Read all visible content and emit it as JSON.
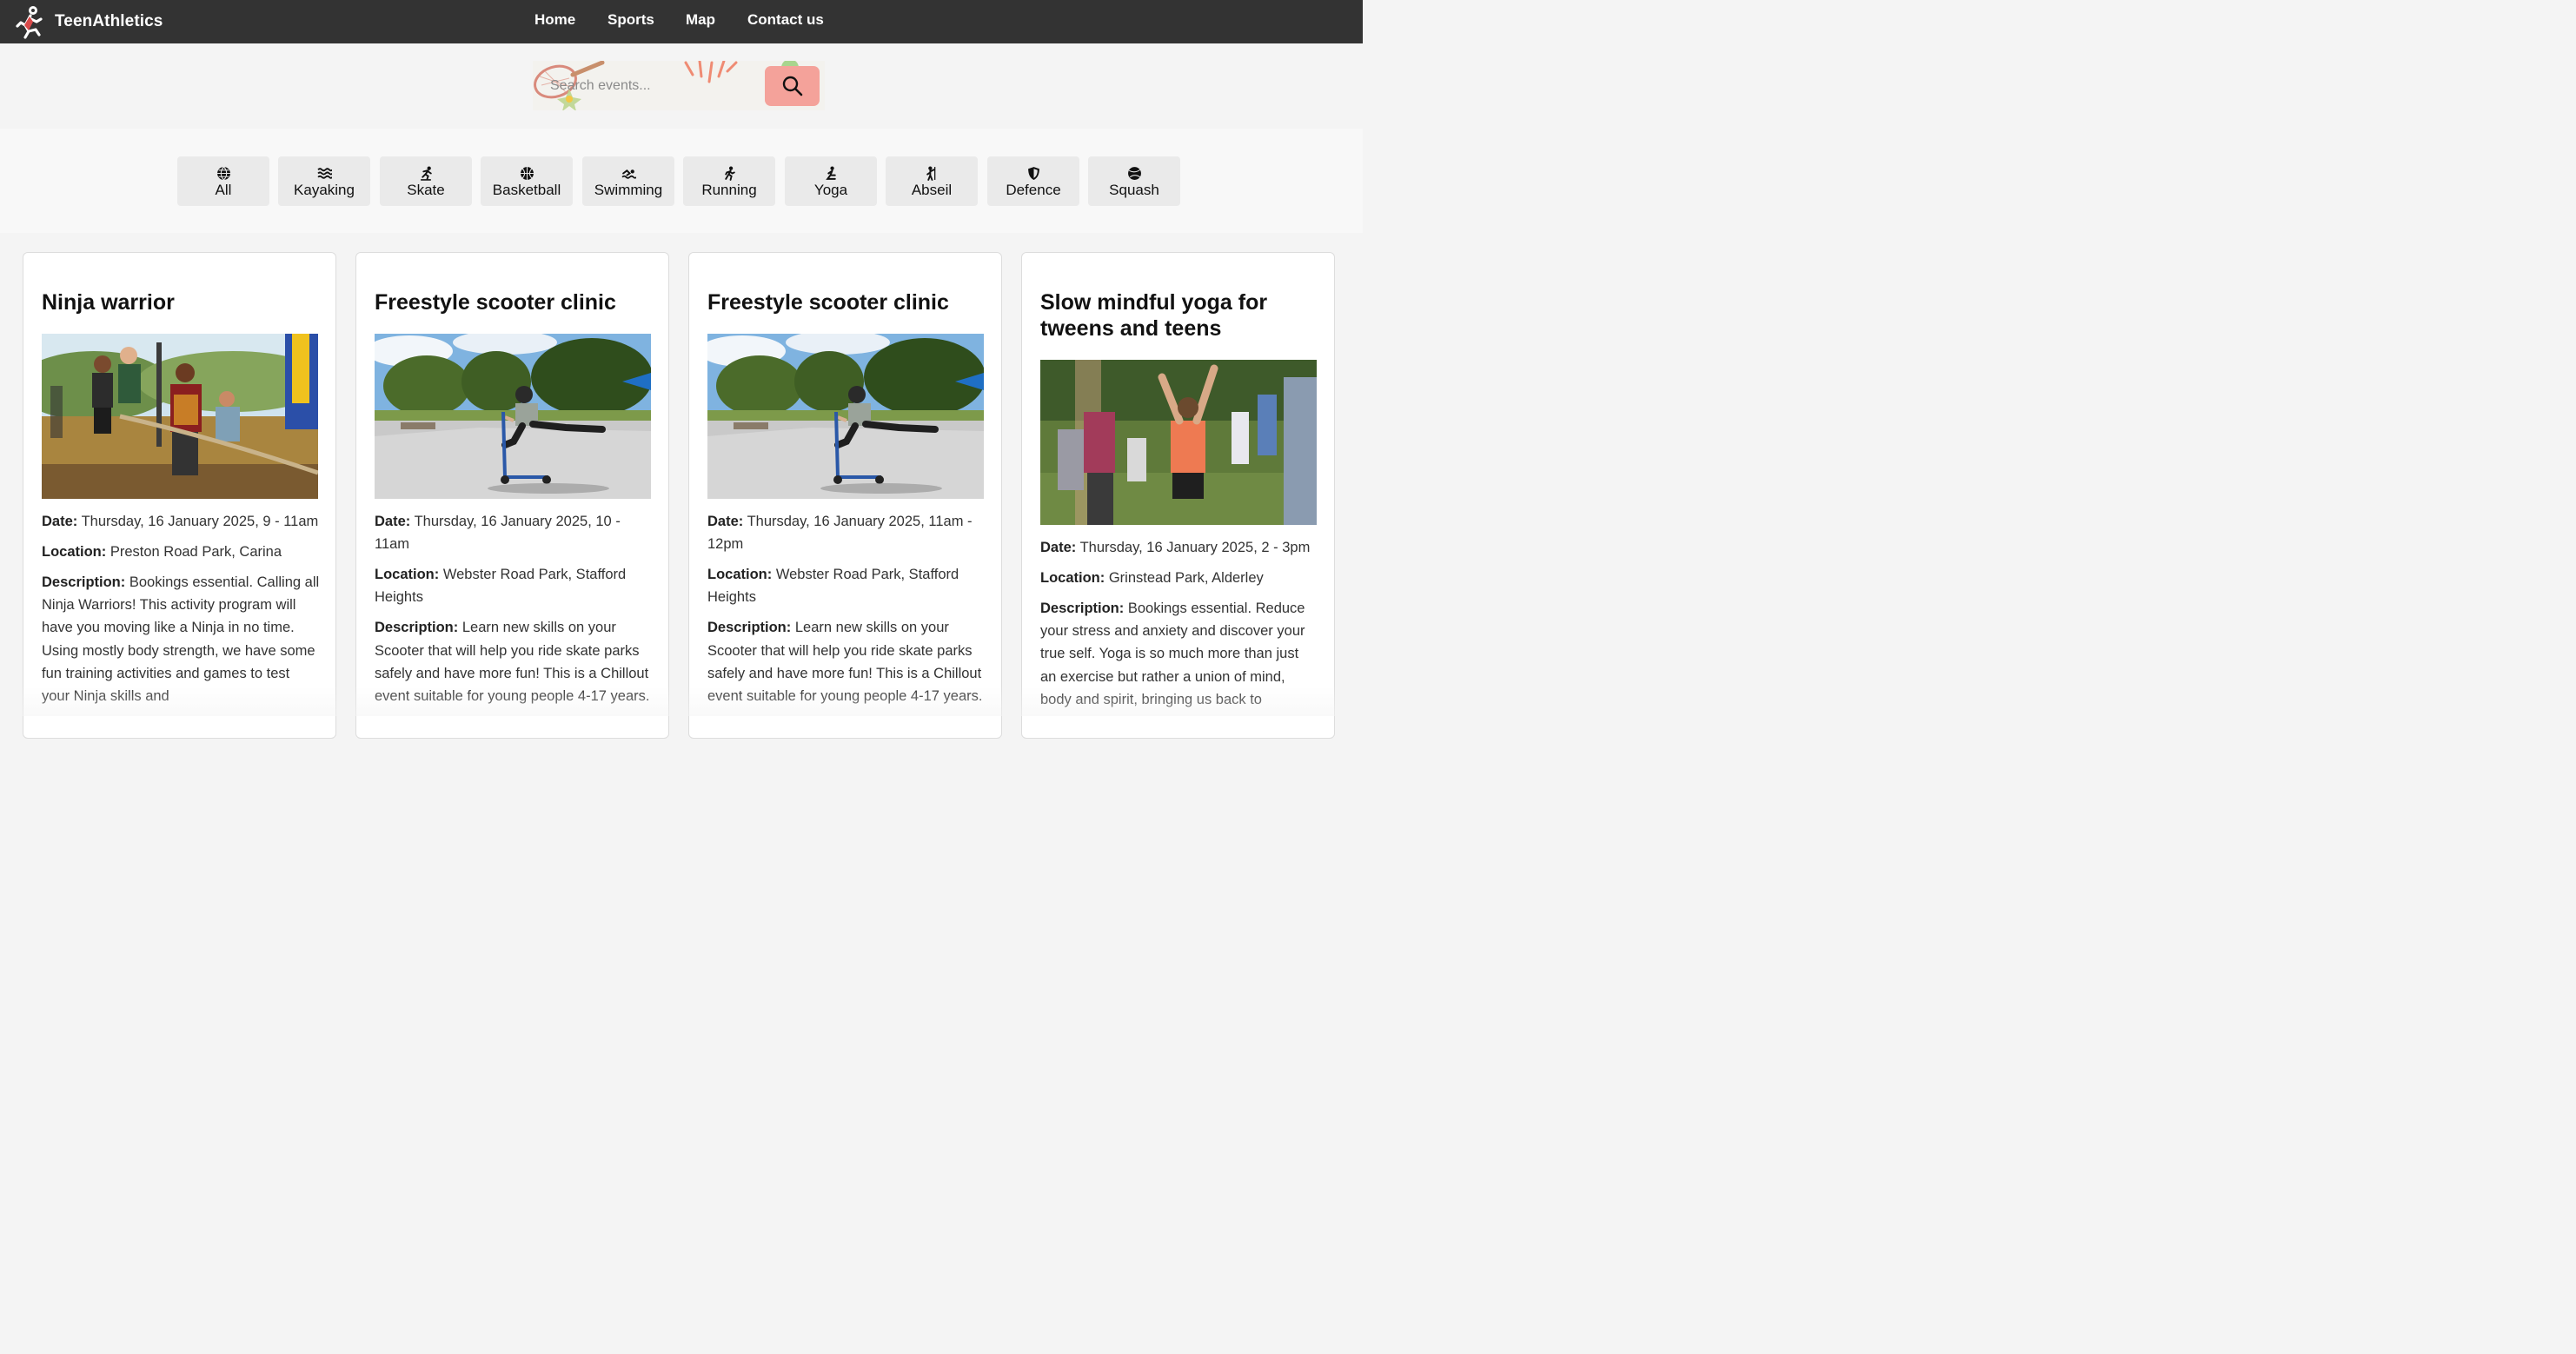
{
  "nav": {
    "brand": "TeenAthletics",
    "links": [
      "Home",
      "Sports",
      "Map",
      "Contact us"
    ]
  },
  "search": {
    "placeholder": "Search events..."
  },
  "filters": [
    {
      "label": "All",
      "icon": "globe-icon"
    },
    {
      "label": "Kayaking",
      "icon": "water-waves-icon"
    },
    {
      "label": "Skate",
      "icon": "skater-icon"
    },
    {
      "label": "Basketball",
      "icon": "basketball-icon"
    },
    {
      "label": "Swimming",
      "icon": "swimmer-icon"
    },
    {
      "label": "Running",
      "icon": "runner-icon"
    },
    {
      "label": "Yoga",
      "icon": "yoga-pose-icon"
    },
    {
      "label": "Abseil",
      "icon": "climber-icon"
    },
    {
      "label": "Defence",
      "icon": "shield-icon"
    },
    {
      "label": "Squash",
      "icon": "ball-icon"
    }
  ],
  "events": [
    {
      "title": "Ninja warrior",
      "date_label": "Date:",
      "date": "Thursday, 16 January 2025, 9 - 11am",
      "location_label": "Location:",
      "location": "Preston Road Park, Carina",
      "description_label": "Description:",
      "description": "Bookings essential. Calling all Ninja Warriors! This activity program will have you moving like a Ninja in no time. Using mostly body strength, we have some fun training activities and games to test your Ninja skills and"
    },
    {
      "title": "Freestyle scooter clinic",
      "date_label": "Date:",
      "date": "Thursday, 16 January 2025, 10 - 11am",
      "location_label": "Location:",
      "location": "Webster Road Park, Stafford Heights",
      "description_label": "Description:",
      "description": "Learn new skills on your Scooter that will help you ride skate parks safely and have more fun! This is a Chillout event suitable for young people 4-17 years."
    },
    {
      "title": "Freestyle scooter clinic",
      "date_label": "Date:",
      "date": "Thursday, 16 January 2025, 11am - 12pm",
      "location_label": "Location:",
      "location": "Webster Road Park, Stafford Heights",
      "description_label": "Description:",
      "description": "Learn new skills on your Scooter that will help you ride skate parks safely and have more fun! This is a Chillout event suitable for young people 4-17 years."
    },
    {
      "title": "Slow mindful yoga for tweens and teens",
      "date_label": "Date:",
      "date": "Thursday, 16 January 2025, 2 - 3pm",
      "location_label": "Location:",
      "location": "Grinstead Park, Alderley",
      "description_label": "Description:",
      "description": "Bookings essential. Reduce your stress and anxiety and discover your true self.  Yoga is so much more than just an exercise but rather a union of mind, body and spirit, bringing us back to"
    }
  ],
  "colors": {
    "navbar": "#333333",
    "search_button": "#f4a29a",
    "page_background": "#f4f4f4",
    "filter_button": "#eaeaea",
    "card_background": "#ffffff"
  }
}
